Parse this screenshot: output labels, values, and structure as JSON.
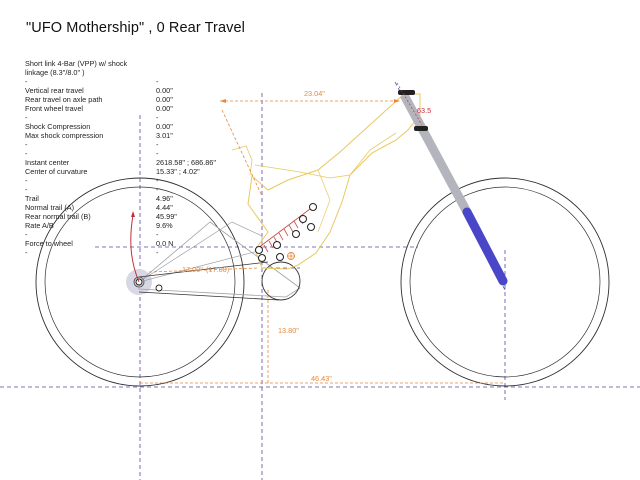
{
  "title": "\"UFO Mothership\" , 0  Rear Travel",
  "parameters": [
    {
      "label": "Short link 4-Bar (VPP) w/ shock linkage (8.3\"/8.0\" )",
      "value": "",
      "wrap": true
    },
    {
      "label": "-",
      "value": "-"
    },
    {
      "label": "Vertical rear travel",
      "value": "0.00\""
    },
    {
      "label": "Rear travel on axle path",
      "value": "0.00\""
    },
    {
      "label": "Front wheel travel",
      "value": "0.00\""
    },
    {
      "label": "-",
      "value": "-"
    },
    {
      "label": "Shock Compression",
      "value": "0.00\""
    },
    {
      "label": "Max shock compression",
      "value": "3.01\""
    },
    {
      "label": "-",
      "value": "-"
    },
    {
      "label": "-",
      "value": "-"
    },
    {
      "label": "Instant center",
      "value": "2618.58\" ; 686.86\""
    },
    {
      "label": "Center of curvature",
      "value": "15.33\" ; 4.02\""
    },
    {
      "label": "-",
      "value": "-"
    },
    {
      "label": "-",
      "value": "-"
    },
    {
      "label": "Trail",
      "value": "4.96\""
    },
    {
      "label": "Normal trail (A)",
      "value": "4.44\""
    },
    {
      "label": "Rear normal trail (B)",
      "value": "45.99\""
    },
    {
      "label": "Rate A/B",
      "value": "9.6%"
    },
    {
      "label": "-",
      "value": "-"
    },
    {
      "label": "Force to wheel",
      "value": "0.0 N"
    },
    {
      "label": "-",
      "value": "-"
    }
  ],
  "dimensions": {
    "reach": "23.04\"",
    "head_tube": "63.5",
    "chainstay_a": "17.00\"",
    "chainstay_b": "(17.00)",
    "bb_drop": "13.80\"",
    "wheelbase": "46.43\""
  },
  "colors": {
    "frame": "#e8c860",
    "dimension": "#e8883a",
    "center_line": "#5a4aa8",
    "fork_lower": "#4a46c8",
    "fork_upper": "#b4b4bc",
    "shock_spring": "#c85050",
    "red_accent": "#c03040",
    "wheel": "#303030"
  }
}
